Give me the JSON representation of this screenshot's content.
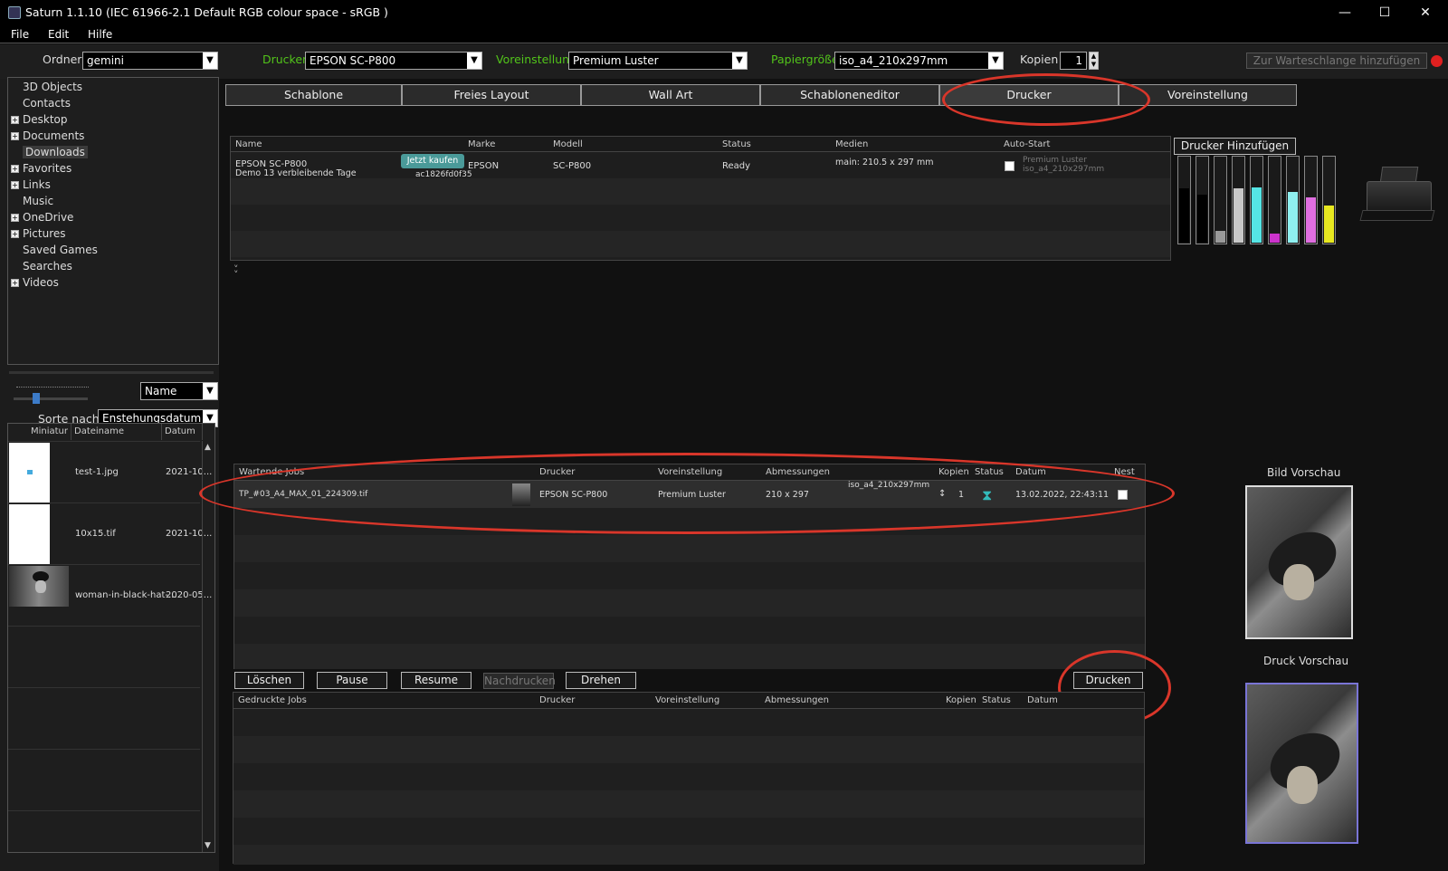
{
  "window": {
    "title": "Saturn 1.1.10 (IEC 61966-2.1 Default RGB colour space - sRGB   )",
    "minimize": "—",
    "maximize": "☐",
    "close": "✕"
  },
  "menu": [
    "File",
    "Edit",
    "Hilfe"
  ],
  "toolbar": {
    "ordner_label": "Ordner",
    "ordner_value": "gemini",
    "drucker_label": "Drucker",
    "drucker_value": "EPSON SC-P800",
    "voreinstellung_label": "Voreinstellung",
    "voreinstellung_value": "Premium Luster",
    "papier_label": "Papiergröße",
    "papier_value": "iso_a4_210x297mm",
    "kopien_label": "Kopien",
    "kopien_value": "1",
    "queue_button": "Zur Warteschlange hinzufügen",
    "status_color": "#e02020"
  },
  "tree": [
    {
      "label": "3D Objects",
      "expand": false
    },
    {
      "label": "Contacts",
      "expand": false
    },
    {
      "label": "Desktop",
      "expand": true
    },
    {
      "label": "Documents",
      "expand": true
    },
    {
      "label": "Downloads",
      "expand": false,
      "selected": true
    },
    {
      "label": "Favorites",
      "expand": true
    },
    {
      "label": "Links",
      "expand": true
    },
    {
      "label": "Music",
      "expand": false
    },
    {
      "label": "OneDrive",
      "expand": true
    },
    {
      "label": "Pictures",
      "expand": true
    },
    {
      "label": "Saved Games",
      "expand": false
    },
    {
      "label": "Searches",
      "expand": false
    },
    {
      "label": "Videos",
      "expand": true
    }
  ],
  "sort": {
    "name_value": "Name",
    "sort_label": "Sorte nach",
    "sort_value": "Enstehungsdatum"
  },
  "files": {
    "headers": [
      "Miniatur",
      "Dateiname",
      "Datum"
    ],
    "rows": [
      {
        "name": "test-1.jpg",
        "date": "2021-10..."
      },
      {
        "name": "10x15.tif",
        "date": "2021-10..."
      },
      {
        "name": "woman-in-black-hat-...",
        "date": "2020-05..."
      }
    ]
  },
  "tabs": [
    "Schablone",
    "Freies Layout",
    "Wall Art",
    "Schabloneneditor",
    "Drucker",
    "Voreinstellung"
  ],
  "printers": {
    "headers": [
      "Name",
      "Marke",
      "Modell",
      "Status",
      "Medien",
      "Auto-Start"
    ],
    "row": {
      "name": "EPSON SC-P800",
      "demo": "Demo 13 verbleibende Tage",
      "buy": "Jetzt kaufen",
      "id": "ac1826fd0f35",
      "marke": "EPSON",
      "modell": "SC-P800",
      "status": "Ready",
      "medien": "main: 210.5 x 297 mm",
      "autostart_line1": "Premium Luster",
      "autostart_line2": "iso_a4_210x297mm"
    },
    "add_button": "Drucker Hinzufügen",
    "inks": [
      {
        "color": "#000000",
        "level": 0.62
      },
      {
        "color": "#000000",
        "level": 0.55
      },
      {
        "color": "#9a9a9a",
        "level": 0.14
      },
      {
        "color": "#c8c8c8",
        "level": 0.62
      },
      {
        "color": "#55e5e5",
        "level": 0.64
      },
      {
        "color": "#cc33cc",
        "level": 0.1
      },
      {
        "color": "#8ff0f0",
        "level": 0.58
      },
      {
        "color": "#e06ee0",
        "level": 0.52
      },
      {
        "color": "#e8e820",
        "level": 0.43
      }
    ]
  },
  "queue": {
    "headers": [
      "Wartende Jobs",
      "Drucker",
      "Voreinstellung",
      "Abmessungen",
      "Kopien",
      "Status",
      "Datum",
      "Nest"
    ],
    "row": {
      "file": "TP_#03_A4_MAX_01_224309.tif",
      "drucker": "EPSON SC-P800",
      "voreinstellung": "Premium Luster",
      "abm": "210 x 297",
      "paper": "iso_a4_210x297mm",
      "kopien": "1",
      "datum": "13.02.2022, 22:43:11"
    }
  },
  "actions": {
    "loeschen": "Löschen",
    "pause": "Pause",
    "resume": "Resume",
    "nachdrucken": "Nachdrucken",
    "drehen": "Drehen",
    "drucken": "Drucken"
  },
  "printed": {
    "headers": [
      "Gedruckte Jobs",
      "Drucker",
      "Voreinstellung",
      "Abmessungen",
      "Kopien",
      "Status",
      "Datum"
    ]
  },
  "preview": {
    "bild": "Bild Vorschau",
    "druck": "Druck Vorschau"
  },
  "annotation_color": "#d9362a"
}
